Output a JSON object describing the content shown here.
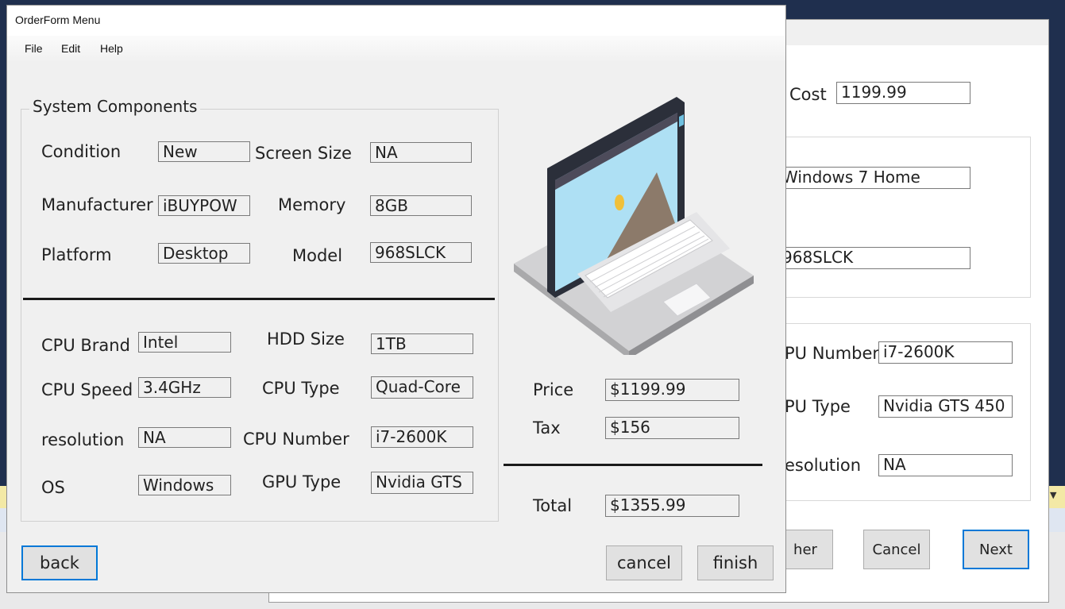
{
  "background_window": {
    "cost_label": "Cost",
    "cost_value": "1199.99",
    "os_value": "Windows 7 Home",
    "model_value": "968SLCK",
    "cpu_number_label": "PU Number",
    "cpu_number_value": "i7-2600K",
    "gpu_type_label": "PU Type",
    "gpu_type_value": "Nvidia GTS 450",
    "resolution_label": "esolution",
    "resolution_value": "NA",
    "other_button": "her",
    "cancel_button": "Cancel",
    "next_button": "Next"
  },
  "window": {
    "title": "OrderForm Menu"
  },
  "menu": [
    "File",
    "Edit",
    "Help"
  ],
  "components": {
    "group_title": "System Components",
    "condition_label": "Condition",
    "condition_value": "New",
    "screen_size_label": "Screen Size",
    "screen_size_value": "NA",
    "manufacturer_label": "Manufacturer",
    "manufacturer_value": "iBUYPOW",
    "memory_label": "Memory",
    "memory_value": "8GB",
    "platform_label": "Platform",
    "platform_value": "Desktop",
    "model_label": "Model",
    "model_value": "968SLCK",
    "cpu_brand_label": "CPU Brand",
    "cpu_brand_value": "Intel",
    "hdd_size_label": "HDD Size",
    "hdd_size_value": "1TB",
    "cpu_speed_label": "CPU Speed",
    "cpu_speed_value": "3.4GHz",
    "cpu_type_label": "CPU Type",
    "cpu_type_value": "Quad-Core",
    "resolution_label": "resolution",
    "resolution_value": "NA",
    "cpu_number_label": "CPU Number",
    "cpu_number_value": "i7-2600K",
    "os_label": "OS",
    "os_value": "Windows",
    "gpu_type_label": "GPU Type",
    "gpu_type_value": "Nvidia GTS"
  },
  "summary": {
    "price_label": "Price",
    "price_value": "$1199.99",
    "tax_label": "Tax",
    "tax_value": "$156",
    "total_label": "Total",
    "total_value": "$1355.99"
  },
  "buttons": {
    "back": "back",
    "cancel": "cancel",
    "finish": "finish"
  },
  "colors": {
    "accent": "#0078d7",
    "window_bg": "#f0f0f0",
    "desktop": "#1f2f4e"
  }
}
